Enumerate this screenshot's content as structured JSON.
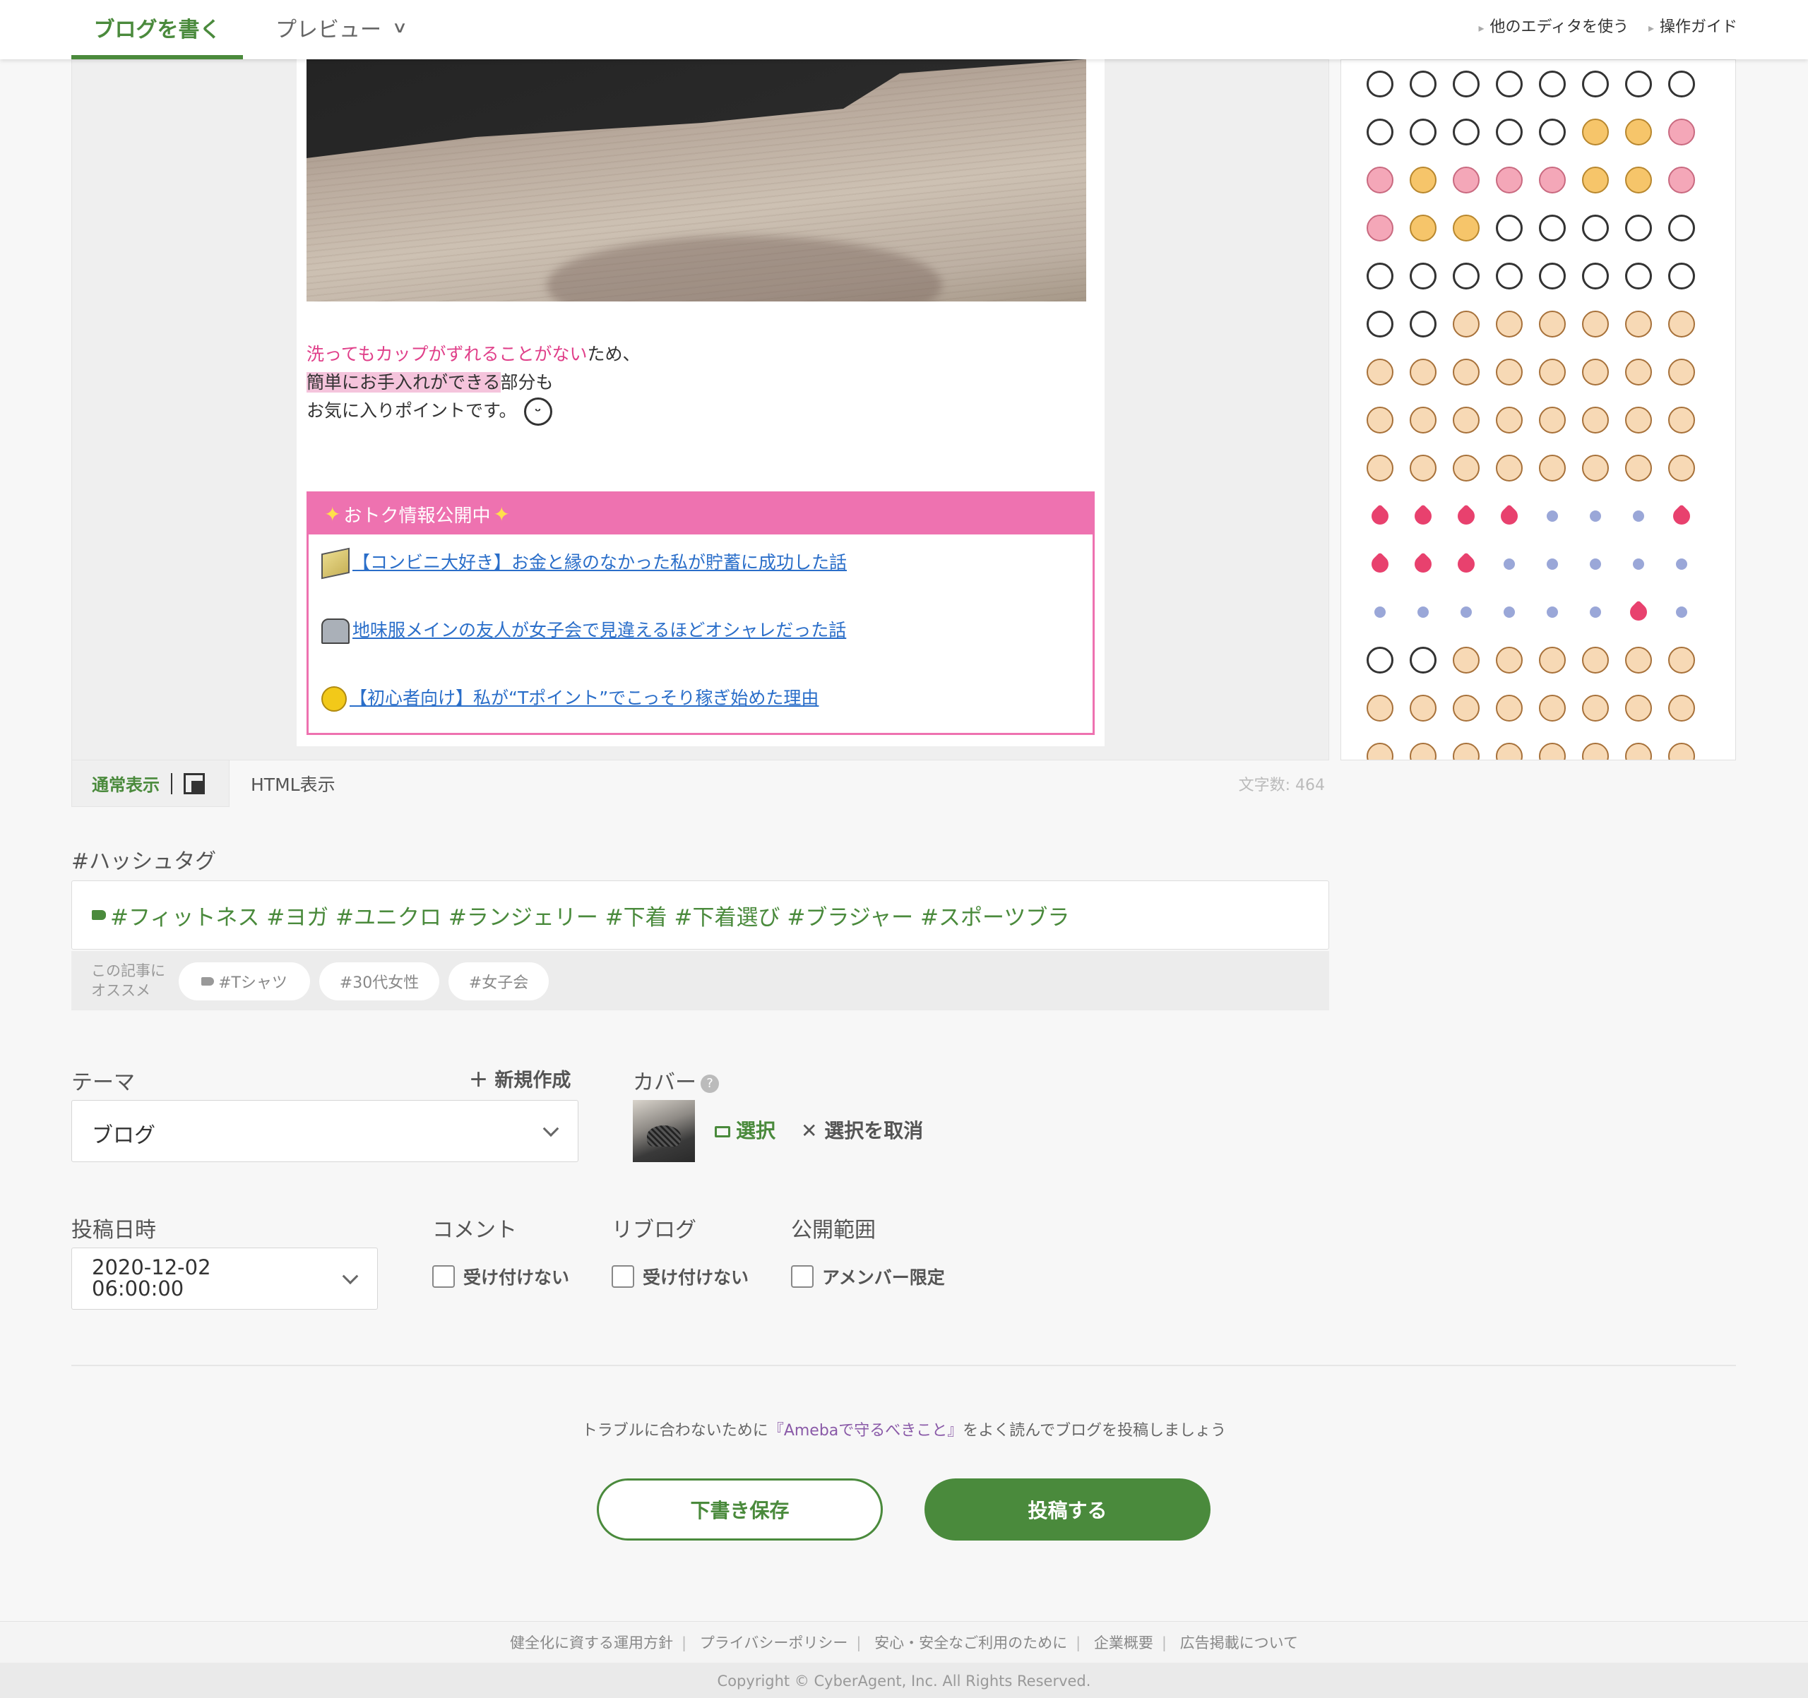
{
  "header": {
    "tab_write": "ブログを書く",
    "tab_preview": "プレビュー",
    "link_other_editor": "他のエディタを使う",
    "link_guide": "操作ガイド"
  },
  "editor": {
    "line1_pink": "洗ってもカップがずれることがない",
    "line1_rest": "ため、",
    "line2_hl": "簡単にお手入れができる",
    "line2_rest": "部分も",
    "line3": "お気に入りポイントです。",
    "emoji_in_text": "😆",
    "box_title": "おトク情報公開中",
    "box_links": [
      "【コンビニ大好き】お金と縁のなかった私が貯蓄に成功した話",
      "地味服メインの友人が女子会で見違えるほどオシャレだった話",
      "【初心者向け】私が“Tポイント”でこっそり稼ぎ始めた理由"
    ]
  },
  "modebar": {
    "normal": "通常表示",
    "html": "HTML表示",
    "charcount": "文字数: 464"
  },
  "hashtag": {
    "label": "#ハッシュタグ",
    "tags": "#フィットネス  #ヨガ  #ユニクロ  #ランジェリー  #下着  #下着選び  #ブラジャー  #スポーツブラ",
    "suggest_caption_1": "この記事に",
    "suggest_caption_2": "オススメ",
    "suggest": [
      "#Tシャツ",
      "#30代女性",
      "#女子会"
    ]
  },
  "theme": {
    "label": "テーマ",
    "new": "＋ 新規作成",
    "value": "ブログ"
  },
  "cover": {
    "label": "カバー",
    "help": "?",
    "select": "選択",
    "cancel": "✕ 選択を取消"
  },
  "post_date": {
    "label": "投稿日時",
    "date": "2020-12-02",
    "time": "06:00:00"
  },
  "comment": {
    "label": "コメント",
    "option": "受け付けない"
  },
  "reblog": {
    "label": "リブログ",
    "option": "受け付けない"
  },
  "visibility": {
    "label": "公開範囲",
    "option": "アメンバー限定"
  },
  "notice": {
    "pre": "トラブルに合わないために",
    "link": "『Amebaで守るべきこと』",
    "post": "をよく読んでブログを投稿しましょう"
  },
  "buttons": {
    "draft": "下書き保存",
    "post": "投稿する"
  },
  "footer": {
    "links": [
      "健全化に資する運用方針",
      "プライバシーポリシー",
      "安心・安全なご利用のために",
      "企業概要",
      "広告掲載について"
    ],
    "copyright": "Copyright © CyberAgent, Inc. All Rights Reserved."
  },
  "colors": {
    "accent": "#4a8a3c",
    "pink": "#ee72b0",
    "link": "#2a6ec9"
  }
}
